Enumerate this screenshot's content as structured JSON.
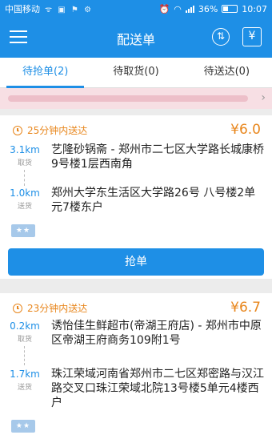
{
  "status_bar": {
    "carrier": "中国移动",
    "icons": [
      "signal-icon",
      "image-icon",
      "location-icon",
      "settings-icon"
    ],
    "battery": "36%",
    "time": "10:07"
  },
  "app_bar": {
    "title": "配送单",
    "sort_icon_glyph": "⇅",
    "yen_icon_glyph": "¥",
    "accent_color": "#1e8fe6"
  },
  "tabs": [
    {
      "label": "待抢单(2)",
      "active": true
    },
    {
      "label": "待取货(0)",
      "active": false
    },
    {
      "label": "待送达(0)",
      "active": false
    }
  ],
  "orders": [
    {
      "time_limit": "25分钟内送达",
      "price": "¥6.0",
      "pickup": {
        "distance": "3.1km",
        "label": "取货",
        "address": "艺隆砂锅斋 - 郑州市二七区大学路长城康桥9号楼1层西南角"
      },
      "dropoff": {
        "distance": "1.0km",
        "label": "送货",
        "address": "郑州大学东生活区大学路26号 八号楼2单元7楼东户"
      },
      "badge": "★★",
      "action_label": "抢单"
    },
    {
      "time_limit": "23分钟内送达",
      "price": "¥6.7",
      "pickup": {
        "distance": "0.2km",
        "label": "取货",
        "address": "诱怡佳生鲜超市(帝湖王府店) - 郑州市中原区帝湖王府商务109附1号"
      },
      "dropoff": {
        "distance": "1.7km",
        "label": "送货",
        "address": "珠江荣域河南省郑州市二七区郑密路与汉江路交叉口珠江荣域北院13号楼5单元4楼西户"
      },
      "badge": "★★"
    }
  ]
}
